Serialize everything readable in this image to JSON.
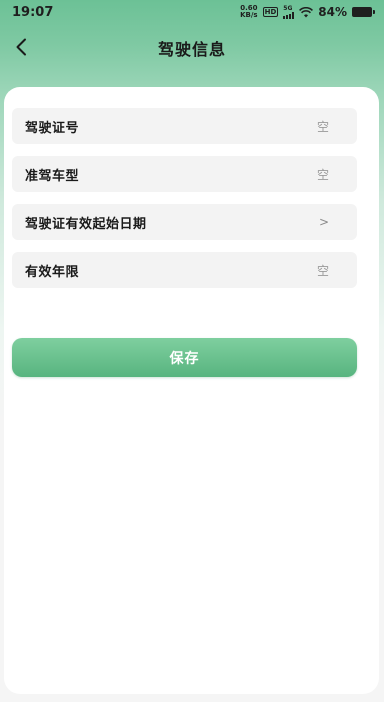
{
  "status_bar": {
    "time": "19:07",
    "net_speed_value": "0.60",
    "net_speed_unit": "KB/s",
    "hd": "HD",
    "signal": "5G",
    "battery": "84%"
  },
  "header": {
    "title": "驾驶信息"
  },
  "form": {
    "rows": [
      {
        "label": "驾驶证号",
        "value": "空"
      },
      {
        "label": "准驾车型",
        "value": "空"
      },
      {
        "label": "驾驶证有效起始日期",
        "value": ">"
      },
      {
        "label": "有效年限",
        "value": "空"
      }
    ]
  },
  "actions": {
    "save_label": "保存"
  },
  "colors": {
    "accent_green": "#57b47f",
    "header_green": "#6cc196"
  }
}
